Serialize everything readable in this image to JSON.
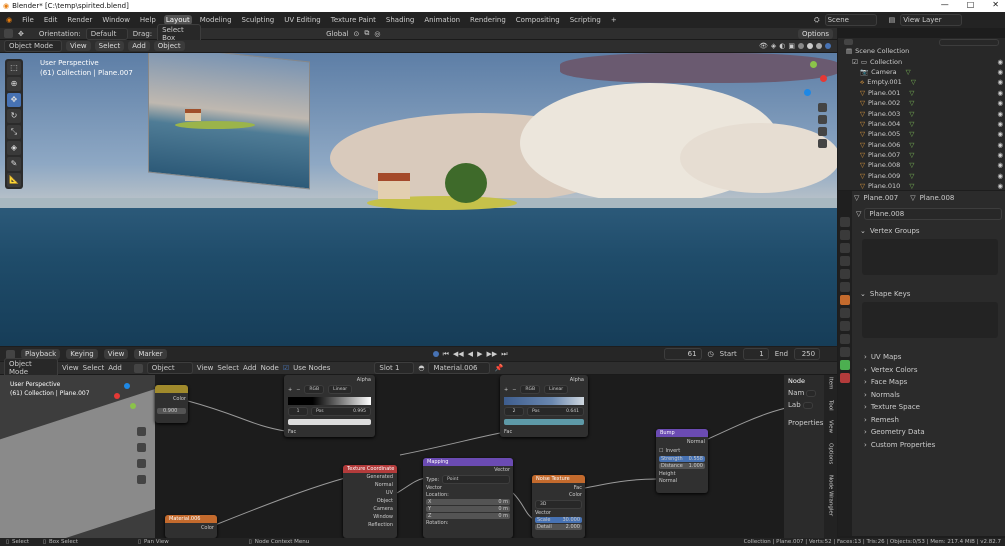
{
  "window": {
    "title": "Blender* [C:\\temp\\spirited.blend]",
    "controls": [
      "—",
      "□",
      "✕"
    ]
  },
  "menu": [
    "File",
    "Edit",
    "Render",
    "Window",
    "Help"
  ],
  "workspaces": [
    "Layout",
    "Modeling",
    "Sculpting",
    "UV Editing",
    "Texture Paint",
    "Shading",
    "Animation",
    "Rendering",
    "Compositing",
    "Scripting",
    "+"
  ],
  "scene": {
    "label": "Scene",
    "view_layer": "View Layer"
  },
  "tool_header": {
    "orientation_label": "Orientation:",
    "orientation": "Default",
    "drag_label": "Drag:",
    "drag": "Select Box",
    "transform": "Global",
    "options": "Options"
  },
  "viewport_header": {
    "mode": "Object Mode",
    "view": "View",
    "select": "Select",
    "add": "Add",
    "object": "Object"
  },
  "viewport": {
    "perspective": "User Perspective",
    "collection": "(61) Collection | Plane.007"
  },
  "outliner": {
    "scene_collection": "Scene Collection",
    "collection": "Collection",
    "items": [
      "Camera",
      "Empty.001",
      "Plane.001",
      "Plane.002",
      "Plane.003",
      "Plane.004",
      "Plane.005",
      "Plane.006",
      "Plane.007",
      "Plane.008",
      "Plane.009",
      "Plane.010"
    ]
  },
  "properties": {
    "tab_a": "Plane.007",
    "tab_b": "Plane.008",
    "mesh": "Plane.008",
    "vertex_groups": "Vertex Groups",
    "shape_keys": "Shape Keys",
    "sections": [
      "UV Maps",
      "Vertex Colors",
      "Face Maps",
      "Normals",
      "Texture Space",
      "Remesh",
      "Geometry Data",
      "Custom Properties"
    ]
  },
  "timeline": {
    "playback": "Playback",
    "keying": "Keying",
    "view": "View",
    "marker": "Marker",
    "frame": "61",
    "start_label": "Start",
    "start": "1",
    "end_label": "End",
    "end": "250"
  },
  "node_editor": {
    "mode": "Object Mode",
    "view": "View",
    "select": "Select",
    "add": "Add",
    "object_type": "Object",
    "view2": "View",
    "select2": "Select",
    "add2": "Add",
    "node": "Node",
    "use_nodes": "Use Nodes",
    "slot": "Slot 1",
    "material": "Material.006",
    "perspective": "User Perspective",
    "collection": "(61) Collection | Plane.007",
    "sidebar_node": "Node",
    "name_label": "Nam",
    "label_label": "Lab",
    "properties": "Properties",
    "side_tabs": [
      "Item",
      "Tool",
      "View",
      "Options",
      "Node Wrangler"
    ]
  },
  "nodes": {
    "color_node": {
      "out": "Color",
      "value": "0.900"
    },
    "ramp1": {
      "alpha": "Alpha",
      "mode": "RGB",
      "interp": "Linear",
      "index": "1",
      "pos_label": "Pos",
      "pos": "0.995",
      "fac": "Fac"
    },
    "ramp2": {
      "alpha": "Alpha",
      "mode": "RGB",
      "interp": "Linear",
      "index": "2",
      "pos_label": "Pos",
      "pos": "0.641",
      "fac": "Fac"
    },
    "bump": {
      "title": "Bump",
      "normal": "Normal",
      "invert": "Invert",
      "strength_label": "Strength",
      "strength": "0.558",
      "distance_label": "Distance",
      "distance": "1.000",
      "height": "Height",
      "normal_in": "Normal"
    },
    "texcoord": {
      "title": "Texture Coordinate",
      "outputs": [
        "Generated",
        "Normal",
        "UV",
        "Object",
        "Camera",
        "Window",
        "Reflection"
      ]
    },
    "mapping": {
      "title": "Mapping",
      "vector": "Vector",
      "type_label": "Type:",
      "type": "Point",
      "vector_in": "Vector",
      "location": "Location:",
      "x": "X",
      "y": "Y",
      "z": "Z",
      "loc": "0 m",
      "rotation": "Rotation:"
    },
    "noise": {
      "title": "Noise Texture",
      "fac": "Fac",
      "color": "Color",
      "dims": "3D",
      "vector": "Vector",
      "scale_label": "Scale",
      "scale": "30.000",
      "detail_label": "Detail",
      "detail": "2.000"
    },
    "material": {
      "title": "Material.006",
      "color": "Color"
    }
  },
  "statusbar": {
    "select": "Select",
    "box_select": "Box Select",
    "pan_view": "Pan View",
    "context": "Node Context Menu",
    "stats": "Collection | Plane.007 | Verts:52 | Faces:13 | Tris:26 | Objects:0/53 | Mem: 217.4 MiB | v2.82.7"
  },
  "colors": {
    "accent": "#4772b3",
    "header": "#2e2e2e",
    "node_red": "#b33b3b",
    "node_purple": "#6b4bb3",
    "node_orange": "#c36a2d",
    "node_yellow": "#a08a2c"
  }
}
